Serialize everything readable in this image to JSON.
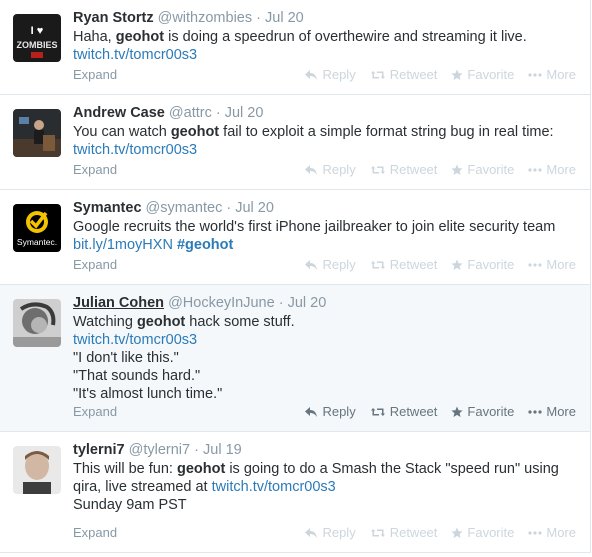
{
  "tweets": [
    {
      "fullname": "Ryan Stortz",
      "username": "@withzombies",
      "sep": "·",
      "time": "Jul 20",
      "text_a": "Haha, ",
      "mention": "geohot",
      "text_b": " is doing a speedrun of overthewire and streaming it live.",
      "link": "twitch.tv/tomcr00s3",
      "avatar_lines": [
        "I ♥",
        "ZOMBIES"
      ]
    },
    {
      "fullname": "Andrew Case",
      "username": "@attrc",
      "sep": "·",
      "time": "Jul 20",
      "text_a": "You can watch ",
      "mention": "geohot",
      "text_b": " fail to exploit a simple format string bug in real time:",
      "link": "twitch.tv/tomcr00s3"
    },
    {
      "fullname": "Symantec",
      "username": "@symantec",
      "sep": "·",
      "time": "Jul 20",
      "text_a": "Google recruits the world's first iPhone jailbreaker to join elite security team",
      "link": "bit.ly/1moyHXN",
      "hashtag": "#geohot",
      "avatar_label": "Symantec."
    },
    {
      "fullname": "Julian Cohen",
      "username": "@HockeyInJune",
      "sep": "·",
      "time": "Jul 20",
      "text_a": "Watching ",
      "mention": "geohot",
      "text_b": " hack some stuff.",
      "link": "twitch.tv/tomcr00s3",
      "quotes": [
        "\"I don't like this.\"",
        "\"That sounds hard.\"",
        "\"It's almost lunch time.\""
      ]
    },
    {
      "fullname": "tylerni7",
      "username": "@tylerni7",
      "sep": "·",
      "time": "Jul 19",
      "text_a": "This will be fun: ",
      "mention": "geohot",
      "text_b": " is going to do a Smash the Stack \"speed run\" using qira, live streamed at ",
      "link": "twitch.tv/tomcr00s3",
      "text_c": "Sunday 9am PST"
    }
  ],
  "footer": {
    "expand": "Expand",
    "reply": "Reply",
    "retweet": "Retweet",
    "favorite": "Favorite",
    "more": "More"
  },
  "icons": [
    "reply-icon",
    "retweet-icon",
    "favorite-icon",
    "more-icon"
  ],
  "colors": {
    "link": "#2b7bb9",
    "muted": "#8899a6",
    "text": "#292f33",
    "hover_bg": "#f5f8fa",
    "divider": "#e1e8ed"
  }
}
